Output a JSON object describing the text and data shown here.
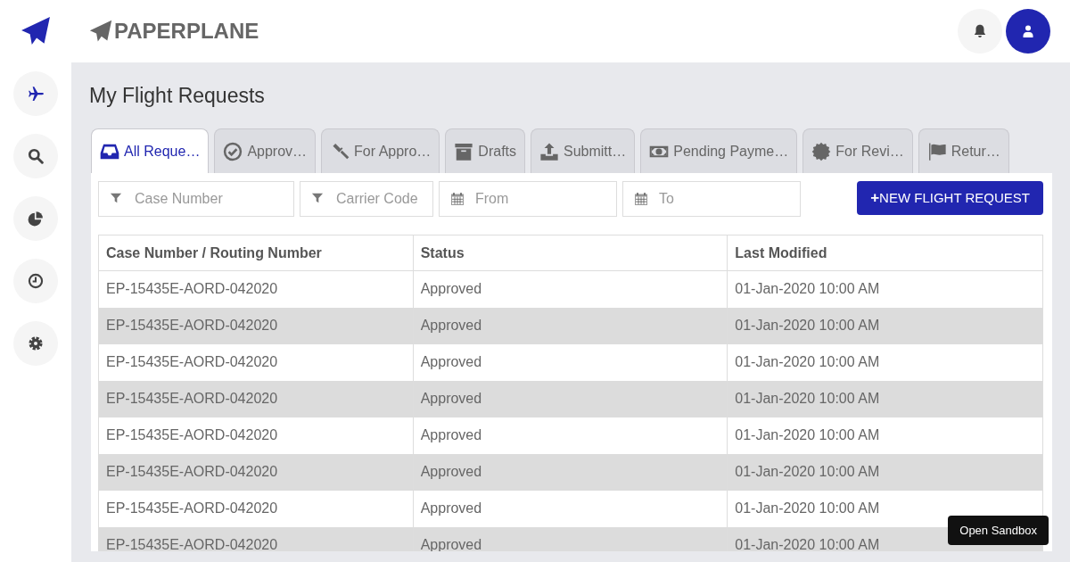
{
  "brand": {
    "name": "PAPERPLANE"
  },
  "sidebar": {
    "items": [
      {
        "selected": true
      },
      {
        "selected": false
      },
      {
        "selected": false
      },
      {
        "selected": false
      },
      {
        "selected": false
      }
    ]
  },
  "page_title": "My Flight Requests",
  "tabs": [
    {
      "label": "All Reque…",
      "selected": true
    },
    {
      "label": "Approv…",
      "selected": false
    },
    {
      "label": "For Appro…",
      "selected": false
    },
    {
      "label": "Drafts",
      "selected": false
    },
    {
      "label": "Submitt…",
      "selected": false
    },
    {
      "label": "Pending Payme…",
      "selected": false
    },
    {
      "label": "For Revi…",
      "selected": false
    },
    {
      "label": "Retur…",
      "selected": false
    }
  ],
  "filters": [
    {
      "kind": "filter",
      "placeholder": "Case Number"
    },
    {
      "kind": "filter",
      "placeholder": "Carrier Code"
    },
    {
      "kind": "date",
      "placeholder": "From"
    },
    {
      "kind": "date",
      "placeholder": "To"
    }
  ],
  "new_button": {
    "icon": "+",
    "label": "NEW FLIGHT REQUEST"
  },
  "table": {
    "columns": [
      "Case Number / Routing Number",
      "Status",
      "Last Modified"
    ],
    "rows": [
      [
        "EP-15435E-AORD-042020",
        "Approved",
        "01-Jan-2020 10:00 AM"
      ],
      [
        "EP-15435E-AORD-042020",
        "Approved",
        "01-Jan-2020 10:00 AM"
      ],
      [
        "EP-15435E-AORD-042020",
        "Approved",
        "01-Jan-2020 10:00 AM"
      ],
      [
        "EP-15435E-AORD-042020",
        "Approved",
        "01-Jan-2020 10:00 AM"
      ],
      [
        "EP-15435E-AORD-042020",
        "Approved",
        "01-Jan-2020 10:00 AM"
      ],
      [
        "EP-15435E-AORD-042020",
        "Approved",
        "01-Jan-2020 10:00 AM"
      ],
      [
        "EP-15435E-AORD-042020",
        "Approved",
        "01-Jan-2020 10:00 AM"
      ],
      [
        "EP-15435E-AORD-042020",
        "Approved",
        "01-Jan-2020 10:00 AM"
      ]
    ]
  },
  "sandbox_button": "Open Sandbox"
}
